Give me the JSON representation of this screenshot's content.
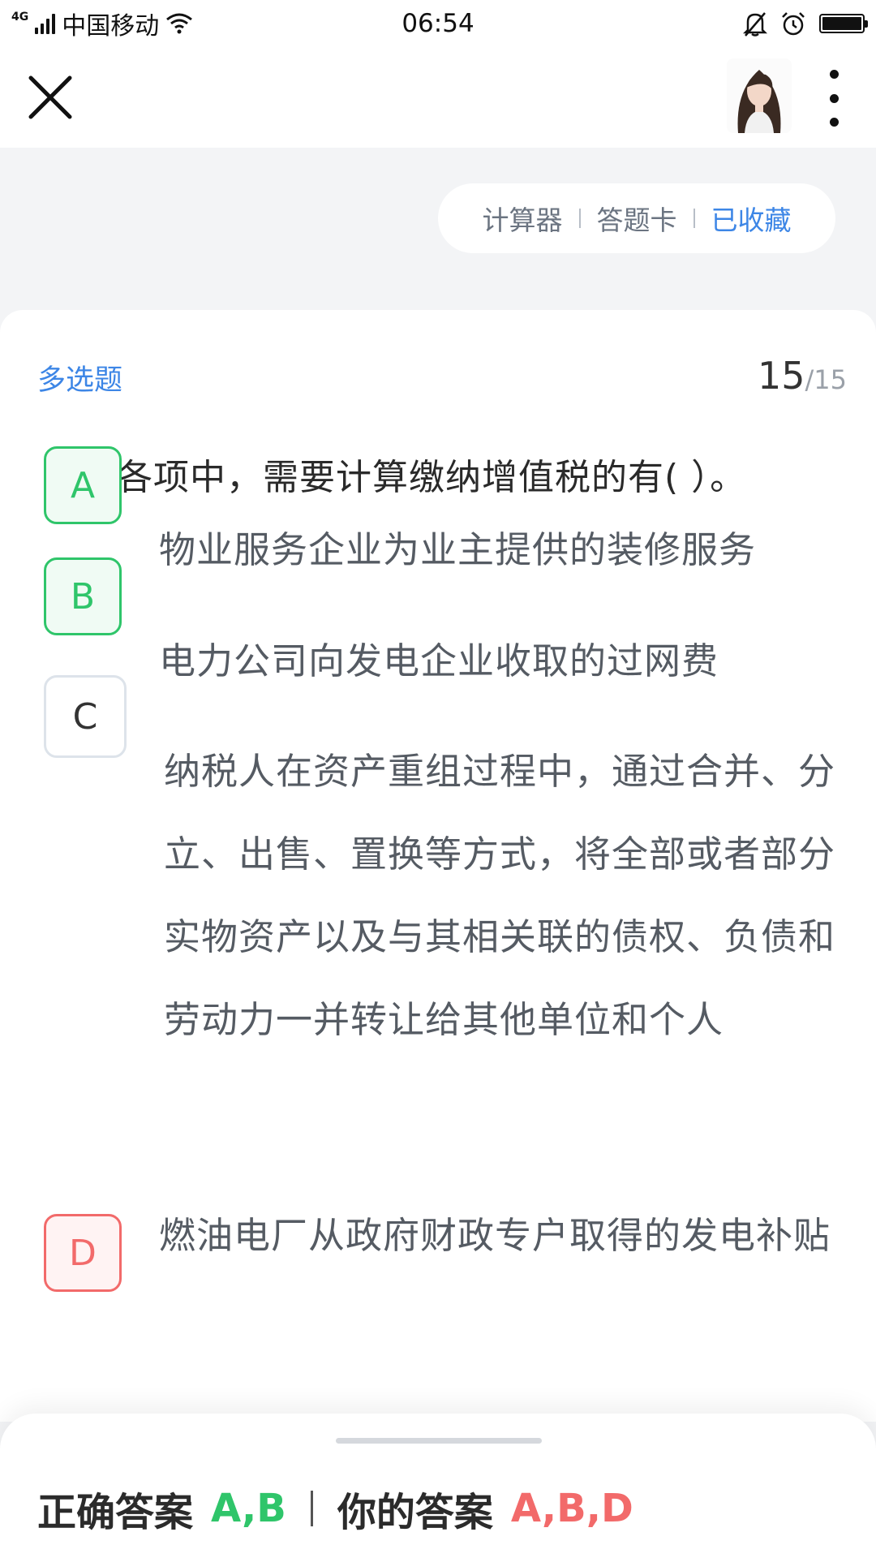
{
  "status_bar": {
    "network": "4G",
    "carrier": "中国移动",
    "time": "06:54"
  },
  "header": {
    "close_icon": "close-icon",
    "more_icon": "more-vertical-icon"
  },
  "toolbar": {
    "calculator": "计算器",
    "answer_card": "答题卡",
    "favorited": "已收藏"
  },
  "question": {
    "type": "多选题",
    "current": "15",
    "total": "/15",
    "text": "下列各项中，需要计算缴纳增值税的有(   ）。",
    "options": [
      {
        "letter": "A",
        "text": "物业服务企业为业主提供的装修服务",
        "state": "correct"
      },
      {
        "letter": "B",
        "text": "电力公司向发电企业收取的过网费",
        "state": "correct"
      },
      {
        "letter": "C",
        "text": "纳税人在资产重组过程中，通过合并、分立、出售、置换等方式，将全部或者部分实物资产以及与其相关联的债权、负债和劳动力一并转让给其他单位和个人",
        "state": "unselected"
      },
      {
        "letter": "D",
        "text": "燃油电厂从政府财政专户取得的发电补贴",
        "state": "wrong"
      }
    ]
  },
  "result": {
    "correct_label": "正确答案",
    "correct_value": "A,B",
    "your_label": "你的答案",
    "your_value": "A,B,D"
  },
  "colors": {
    "accent_blue": "#3d86e6",
    "correct_green": "#2fc56a",
    "wrong_red": "#f26a6a"
  }
}
